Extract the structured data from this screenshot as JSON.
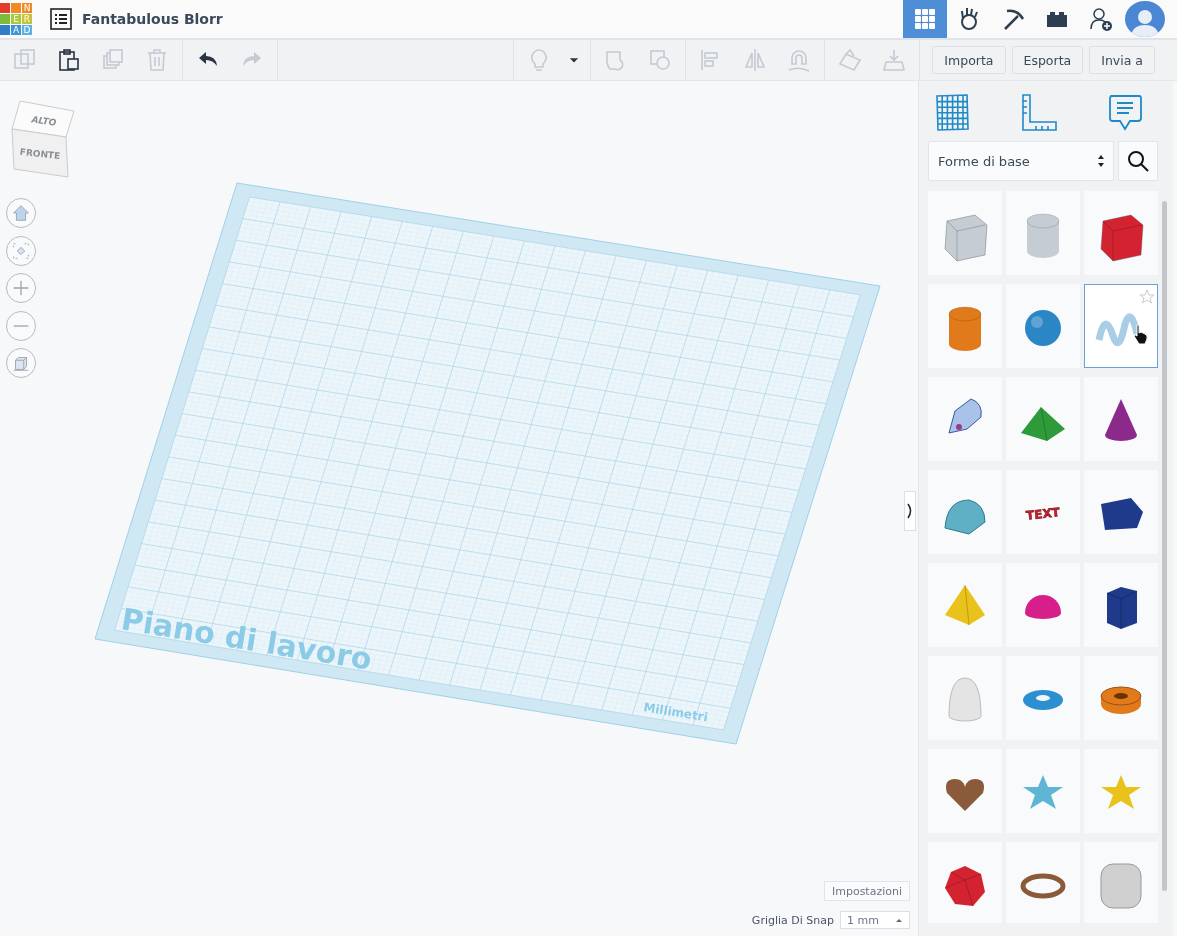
{
  "logo": {
    "cells": [
      {
        "color": "#e23b2e"
      },
      {
        "color": "#f08a24"
      },
      {
        "color": "#f08a24",
        "letter": "N"
      },
      {
        "color": "#7cbc3a"
      },
      {
        "color": "#a8c93a",
        "letter": "E"
      },
      {
        "color": "#c9c33a",
        "letter": "R"
      },
      {
        "color": "#2f7fc8"
      },
      {
        "color": "#3d94d6",
        "letter": "A"
      },
      {
        "color": "#5fb0e0",
        "letter": "D"
      }
    ]
  },
  "design": {
    "title": "Fantabulous Blorr"
  },
  "nav": [
    {
      "kind": "grid",
      "selected": true
    },
    {
      "kind": "hand",
      "selected": false
    },
    {
      "kind": "pickaxe",
      "selected": false
    },
    {
      "kind": "brick",
      "selected": false
    },
    {
      "kind": "add-user",
      "selected": false
    },
    {
      "kind": "avatar",
      "selected": false
    }
  ],
  "toolbar": {
    "left_groups": [
      [
        {
          "kind": "copy",
          "disabled": true
        },
        {
          "kind": "paste",
          "disabled": false
        },
        {
          "kind": "duplicate",
          "disabled": true
        },
        {
          "kind": "delete",
          "disabled": true
        }
      ],
      [
        {
          "kind": "undo",
          "disabled": false
        },
        {
          "kind": "redo",
          "disabled": true
        }
      ]
    ],
    "right_groups": [
      [
        {
          "kind": "bulb",
          "disabled": true
        },
        {
          "kind": "caret",
          "disabled": false
        }
      ],
      [
        {
          "kind": "group",
          "disabled": true
        },
        {
          "kind": "ungroup",
          "disabled": true
        }
      ],
      [
        {
          "kind": "align",
          "disabled": true
        },
        {
          "kind": "mirror",
          "disabled": true
        },
        {
          "kind": "magnet",
          "disabled": true
        }
      ],
      [
        {
          "kind": "workplane",
          "disabled": true
        },
        {
          "kind": "drop",
          "disabled": true
        }
      ]
    ],
    "buttons": [
      "Importa",
      "Esporta",
      "Invia a"
    ]
  },
  "view_cube": {
    "top": "ALTO",
    "front": "FRONTE"
  },
  "view_controls": [
    {
      "kind": "home"
    },
    {
      "kind": "fit"
    },
    {
      "kind": "zoom-in"
    },
    {
      "kind": "zoom-out"
    },
    {
      "kind": "ortho"
    }
  ],
  "workplane": {
    "label": "Piano di lavoro",
    "units": "Millimetri"
  },
  "settings_button": "Impostazioni",
  "snap": {
    "label": "Griglia Di Snap",
    "value": "1 mm"
  },
  "panel": {
    "tabs": [
      {
        "kind": "grid"
      },
      {
        "kind": "ruler"
      },
      {
        "kind": "note"
      }
    ],
    "library": "Forme di base",
    "shapes": [
      {
        "kind": "box",
        "color": "#c6ccd4",
        "selected": false
      },
      {
        "kind": "cylinder",
        "color": "#c6ccd4",
        "selected": false
      },
      {
        "kind": "box",
        "color": "#d32330",
        "selected": false
      },
      {
        "kind": "cylinder",
        "color": "#e07a1a",
        "selected": false
      },
      {
        "kind": "sphere",
        "color": "#2b86c6",
        "selected": false
      },
      {
        "kind": "scribble",
        "color": "#a9cde6",
        "selected": true
      },
      {
        "kind": "pen",
        "color": "#a8c2ea",
        "selected": false
      },
      {
        "kind": "roof",
        "color": "#2f9a3a",
        "selected": false
      },
      {
        "kind": "cone",
        "color": "#8c2a8c",
        "selected": false
      },
      {
        "kind": "round-roof",
        "color": "#5fb0c4",
        "selected": false
      },
      {
        "kind": "text",
        "color": "#c8202c",
        "text": "TEXT",
        "selected": false
      },
      {
        "kind": "wedge",
        "color": "#1f3a8a",
        "selected": false
      },
      {
        "kind": "pyramid",
        "color": "#e9c21c",
        "selected": false
      },
      {
        "kind": "half-sphere",
        "color": "#d61f8a",
        "selected": false
      },
      {
        "kind": "prism",
        "color": "#1f3a8a",
        "selected": false
      },
      {
        "kind": "paraboloid",
        "color": "#e4e4e4",
        "selected": false
      },
      {
        "kind": "torus",
        "color": "#2b8fd0",
        "selected": false
      },
      {
        "kind": "tube",
        "color": "#e07a1a",
        "selected": false
      },
      {
        "kind": "heart",
        "color": "#8a5a3a",
        "selected": false
      },
      {
        "kind": "star",
        "color": "#5fb6d4",
        "selected": false
      },
      {
        "kind": "star",
        "color": "#e9c21c",
        "selected": false
      },
      {
        "kind": "icosahedron",
        "color": "#d32330",
        "selected": false
      },
      {
        "kind": "ring",
        "color": "#8a5a3a",
        "selected": false
      },
      {
        "kind": "rounded-cube",
        "color": "#d0d0d0",
        "selected": false
      }
    ]
  }
}
